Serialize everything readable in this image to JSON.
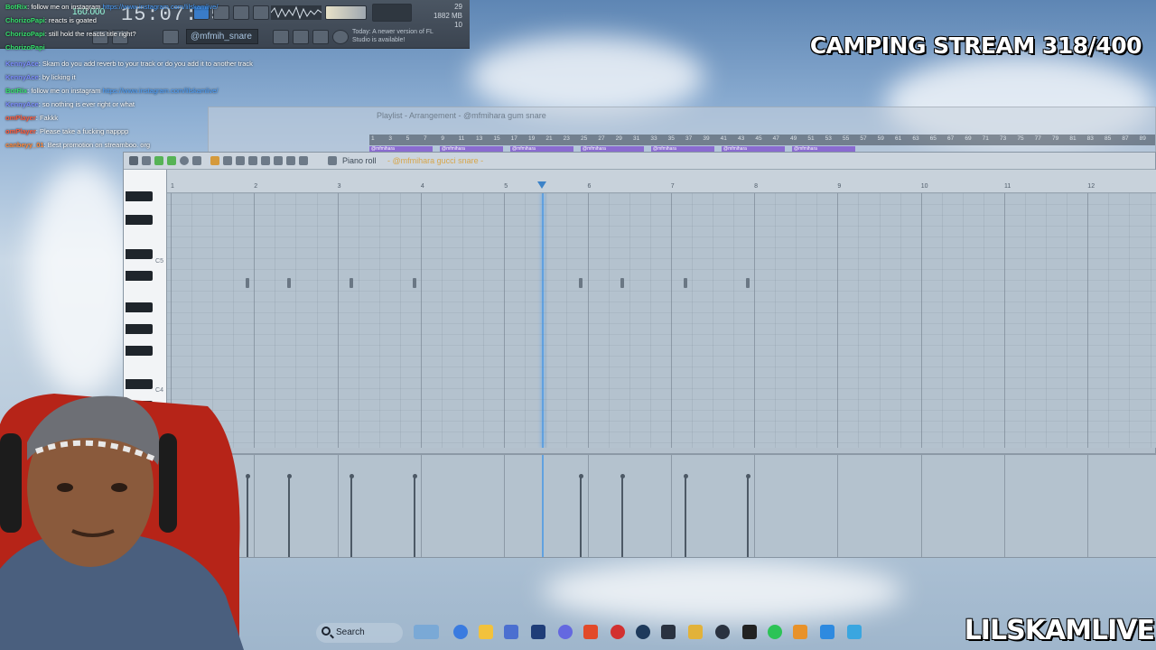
{
  "stream": {
    "title": "CAMPING STREAM 318/400",
    "channel": "LILSKAMLIVE"
  },
  "fl_toolbar": {
    "time": "15:07:15",
    "bpm": "160.000",
    "cpu_top": "29",
    "memory": "1882 MB",
    "cpu_bottom": "10",
    "pattern": "@mfmih_snare",
    "news": "Today: A newer version of FL Studio is available!"
  },
  "chat": [
    {
      "user": "BotRix",
      "text": ": follow me on instagram ",
      "link": "https://www.instagram.com/lilskamlive/",
      "color": "#35e06c"
    },
    {
      "user": "ChorizoPapi",
      "text": ": reacts is goated",
      "link": "",
      "color": "#35e06c"
    },
    {
      "user": "ChorizoPapi",
      "text": ": still hold the reacts title right?",
      "link": "",
      "color": "#35e06c"
    },
    {
      "user": "ChorizoPapi",
      "text": "",
      "link": "",
      "color": "#35e06c"
    },
    {
      "user": "KennyAce",
      "text": ": Skam do you add reverb to your track or do you add it to another track",
      "link": "",
      "color": "#7c8cff"
    },
    {
      "user": "KennyAce",
      "text": ": by licking it",
      "link": "",
      "color": "#7c8cff"
    },
    {
      "user": "BotRix",
      "text": ": follow me on instagram ",
      "link": "https://www.instagram.com/lilskamlive/",
      "color": "#35e06c"
    },
    {
      "user": "KennyAce",
      "text": ": so nothing is ever right or what",
      "link": "",
      "color": "#7c8cff"
    },
    {
      "user": "omPlayer",
      "text": ": Fakkk",
      "link": "",
      "color": "#ff5a3c"
    },
    {
      "user": "omPlayer",
      "text": ": Please take a fucking napppp",
      "link": "",
      "color": "#ff5a3c"
    },
    {
      "user": "canbeyy_01",
      "text": ": Best promotion on streamboo. org",
      "link": "",
      "color": "#ff8a3c"
    }
  ],
  "playlist": {
    "title": "Playlist - Arrangement - @mfmihara gum snare",
    "ruler_ticks": [
      "1",
      "3",
      "5",
      "7",
      "9",
      "11",
      "13",
      "15",
      "17",
      "19",
      "21",
      "23",
      "25",
      "27",
      "29",
      "31",
      "33",
      "35",
      "37",
      "39",
      "41",
      "43",
      "45",
      "47",
      "49",
      "51",
      "53",
      "55",
      "57",
      "59",
      "61",
      "63",
      "65",
      "67",
      "69",
      "71",
      "73",
      "75",
      "77",
      "79",
      "81",
      "83",
      "85",
      "87",
      "89"
    ],
    "clip_label": "@mfmihara"
  },
  "piano_roll": {
    "label": "Piano roll",
    "pattern": "- @mfmihara gucci snare -",
    "bar_numbers": [
      "1",
      "2",
      "3",
      "4",
      "5",
      "6",
      "7",
      "8",
      "9",
      "10",
      "11",
      "12"
    ],
    "octave_labels": [
      "C5",
      "C4"
    ]
  },
  "taskbar": {
    "search_label": "Search"
  }
}
